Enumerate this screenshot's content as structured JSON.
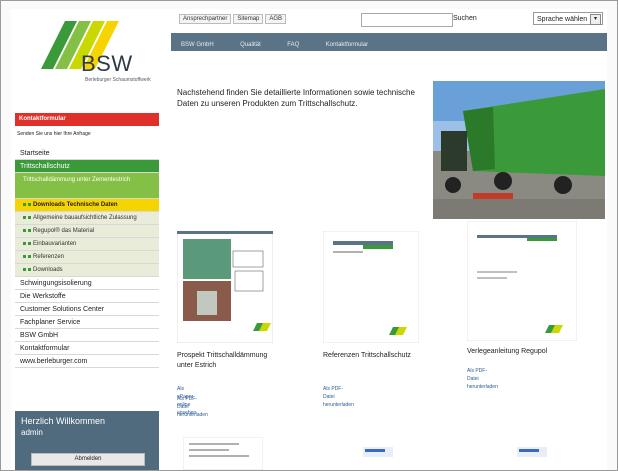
{
  "logo": {
    "name": "BSW",
    "subtitle": "Berleburger Schaumstoffwerk"
  },
  "sidebar": {
    "contact_label": "Kontaktformular",
    "contact_sub": "Senden Sie uns hier Ihre Anfrage",
    "items": [
      {
        "label": "Startseite",
        "type": "item"
      },
      {
        "label": "Trittschallschutz",
        "type": "active"
      },
      {
        "label": "Trittschalldämmung unter Zementestrich",
        "type": "sub"
      },
      {
        "label": "Downloads Technische Daten",
        "type": "selected"
      },
      {
        "label": "Allgemeine bauaufsichtliche Zulassung",
        "type": "dots"
      },
      {
        "label": "Regupol® das Material",
        "type": "dots"
      },
      {
        "label": "Einbauvarianten",
        "type": "dots"
      },
      {
        "label": "Referenzen",
        "type": "dots"
      },
      {
        "label": "Downloads",
        "type": "dots"
      },
      {
        "label": "Schwingungsisolierung",
        "type": "item"
      },
      {
        "label": "Die Werkstoffe",
        "type": "item"
      },
      {
        "label": "Customer Solutions Center",
        "type": "item"
      },
      {
        "label": "Fachplaner Service",
        "type": "item"
      },
      {
        "label": "BSW GmbH",
        "type": "item"
      },
      {
        "label": "Kontaktformular",
        "type": "item"
      },
      {
        "label": "www.berleburger.com",
        "type": "item"
      }
    ],
    "welcome_title": "Herzlich Willkommen",
    "welcome_user": "admin",
    "welcome_button": "Abmelden"
  },
  "topbar": {
    "links": [
      "Ansprechpartner",
      "Sitemap",
      "AGB"
    ],
    "search_button": "Suchen",
    "language": "Sprache wählen"
  },
  "navbar": [
    "BSW GmbH",
    "Qualität",
    "FAQ",
    "Kontaktformular"
  ],
  "intro": "Nachstehend finden Sie detaillierte Informationen sowie technische Daten zu unseren Produkten zum Trittschallschutz.",
  "products": [
    {
      "title": "Prospekt Trittschalldämmung unter Estrich",
      "links": [
        "Als ePaper online ansehen",
        "Als PDF-Datei herunterladen"
      ]
    },
    {
      "title": "Referenzen Trittschallschutz",
      "links": [
        "Als PDF-Datei herunterladen"
      ]
    },
    {
      "title": "Verlegeanleitung Regupol",
      "links": [
        "Als PDF-Datei herunterladen"
      ]
    }
  ],
  "colors": {
    "accent_green": "#3a9a3a",
    "lime": "#84c046",
    "yellow": "#f5d400",
    "red": "#e0302a",
    "slate": "#5a7386"
  }
}
